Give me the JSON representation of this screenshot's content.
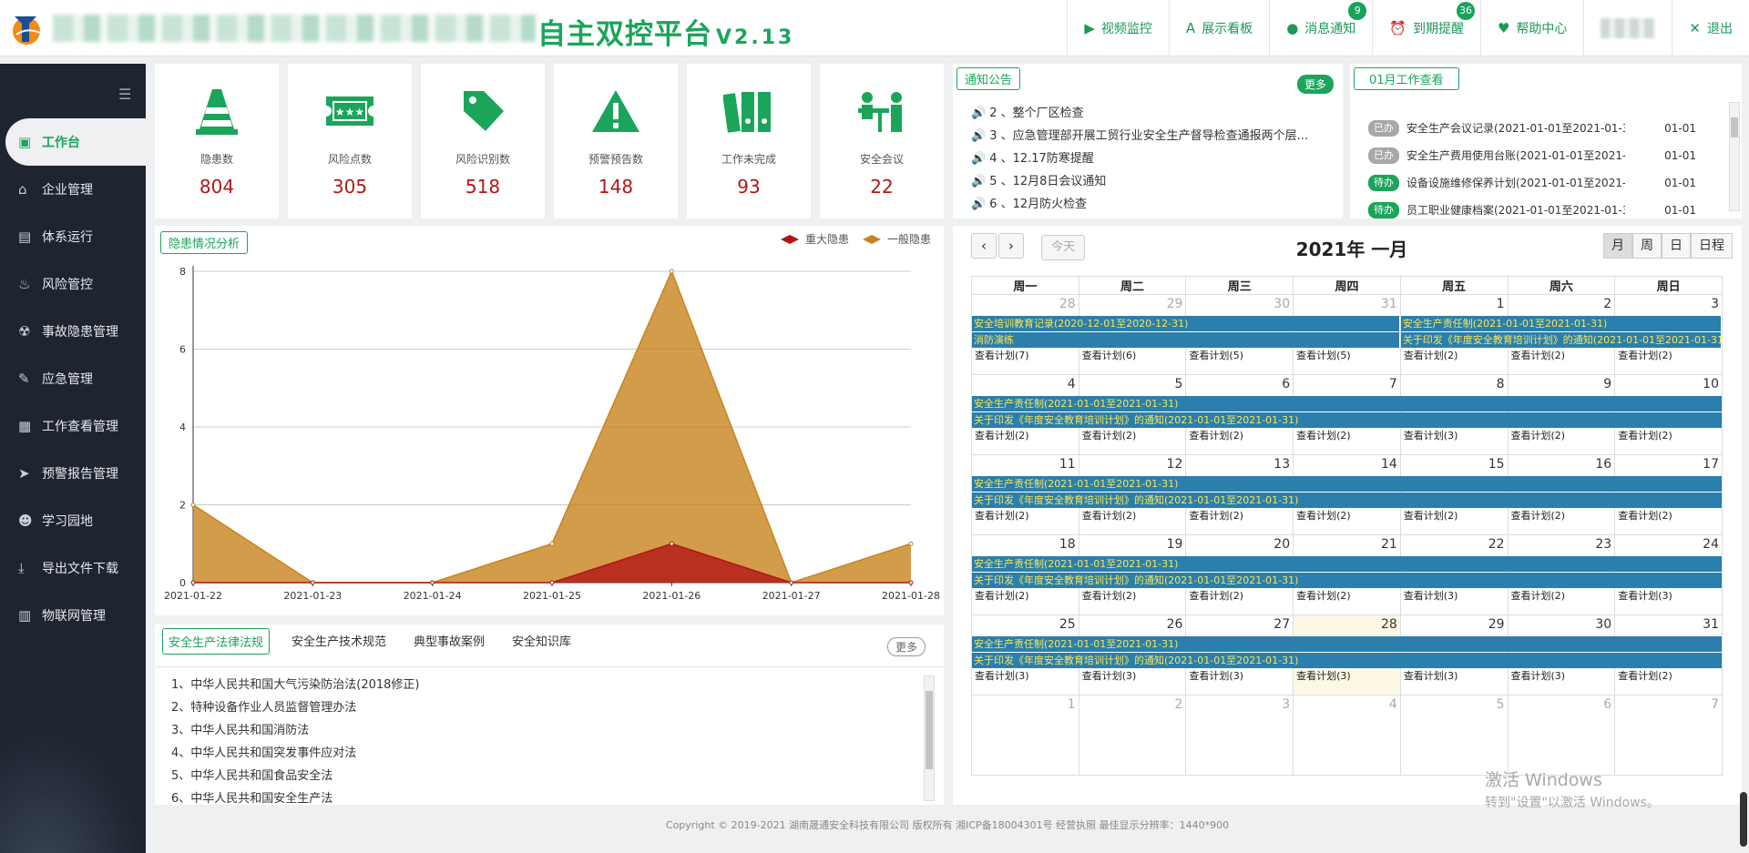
{
  "header": {
    "brand": "自主双控平台",
    "version": "V2.13",
    "nav": [
      {
        "label": "视频监控",
        "icon": "video-icon"
      },
      {
        "label": "展示看板",
        "icon": "board-icon"
      },
      {
        "label": "消息通知",
        "icon": "message-icon",
        "badge": "9"
      },
      {
        "label": "到期提醒",
        "icon": "alarm-icon",
        "badge": "36"
      },
      {
        "label": "帮助中心",
        "icon": "heart-icon"
      },
      {
        "label": "退出",
        "icon": "close-icon"
      }
    ]
  },
  "sidebar": {
    "items": [
      {
        "label": "工作台",
        "icon": "briefcase-icon"
      },
      {
        "label": "企业管理",
        "icon": "home-icon"
      },
      {
        "label": "体系运行",
        "icon": "document-icon"
      },
      {
        "label": "风险管控",
        "icon": "fire-icon"
      },
      {
        "label": "事故隐患管理",
        "icon": "radiation-icon"
      },
      {
        "label": "应急管理",
        "icon": "edit-icon"
      },
      {
        "label": "工作查看管理",
        "icon": "calendar-icon"
      },
      {
        "label": "预警报告管理",
        "icon": "send-icon"
      },
      {
        "label": "学习园地",
        "icon": "student-icon"
      },
      {
        "label": "导出文件下载",
        "icon": "download-icon"
      },
      {
        "label": "物联网管理",
        "icon": "file-icon"
      }
    ]
  },
  "stats": [
    {
      "label": "隐患数",
      "value": "804",
      "icon": "traffic-cone-icon"
    },
    {
      "label": "风险点数",
      "value": "305",
      "icon": "ticket-icon"
    },
    {
      "label": "风险识别数",
      "value": "518",
      "icon": "tag-icon"
    },
    {
      "label": "预警预告数",
      "value": "148",
      "icon": "warning-icon"
    },
    {
      "label": "工作未完成",
      "value": "93",
      "icon": "binders-icon"
    },
    {
      "label": "安全会议",
      "value": "22",
      "icon": "meeting-icon"
    }
  ],
  "notice": {
    "title": "通知公告",
    "more": "更多",
    "items": [
      "2 、整个厂区检查",
      "3 、应急管理部开展工贸行业安全生产督导检查通报两个层...",
      "4 、12.17防寒提醒",
      "5 、12月8日会议通知",
      "6 、12月防火检查"
    ]
  },
  "work": {
    "title": "01月工作查看",
    "items": [
      {
        "status": "已办",
        "type": "done",
        "text": "安全生产会议记录(2021-01-01至2021-01-31)",
        "date": "01-01"
      },
      {
        "status": "已办",
        "type": "done",
        "text": "安全生产费用使用台账(2021-01-01至2021-01-...",
        "date": "01-01"
      },
      {
        "status": "待办",
        "type": "wait",
        "text": "设备设施维修保养计划(2021-01-01至2021-01-...",
        "date": "01-01"
      },
      {
        "status": "待办",
        "type": "wait",
        "text": "员工职业健康档案(2021-01-01至2021-01-31)",
        "date": "01-01"
      }
    ]
  },
  "chart_data": {
    "type": "area",
    "title": "隐患情况分析",
    "categories": [
      "2021-01-22",
      "2021-01-23",
      "2021-01-24",
      "2021-01-25",
      "2021-01-26",
      "2021-01-27",
      "2021-01-28"
    ],
    "series": [
      {
        "name": "重大隐患",
        "values": [
          0,
          0,
          0,
          0,
          1,
          0,
          0
        ],
        "color": "#b31515"
      },
      {
        "name": "一般隐患",
        "values": [
          2,
          0,
          0,
          1,
          8,
          0,
          1
        ],
        "color": "#c8831d"
      }
    ],
    "yticks": [
      "0",
      "2",
      "4",
      "6",
      "8"
    ],
    "ylim": [
      0,
      8
    ],
    "grid": true,
    "legend": "top-right"
  },
  "laws": {
    "tabs": [
      "安全生产法律法规",
      "安全生产技术规范",
      "典型事故案例",
      "安全知识库"
    ],
    "more": "更多",
    "items": [
      "1、中华人民共和国大气污染防治法(2018修正)",
      "2、特种设备作业人员监督管理办法",
      "3、中华人民共和国消防法",
      "4、中华人民共和国突发事件应对法",
      "5、中华人民共和国食品安全法",
      "6、中华人民共和国安全生产法"
    ]
  },
  "calendar": {
    "title": "2021年 一月",
    "today": "今天",
    "views": [
      "月",
      "周",
      "日",
      "日程"
    ],
    "weekdays": [
      "周一",
      "周二",
      "周三",
      "周四",
      "周五",
      "周六",
      "周日"
    ],
    "weeks": [
      {
        "days": [
          {
            "n": "28",
            "o": true
          },
          {
            "n": "29",
            "o": true
          },
          {
            "n": "30",
            "o": true
          },
          {
            "n": "31",
            "o": true
          },
          {
            "n": "1"
          },
          {
            "n": "2"
          },
          {
            "n": "3"
          }
        ],
        "events": [
          {
            "start": 0,
            "span": 4,
            "text": "安全培训教育记录(2020-12-01至2020-12-31)",
            "row": 0
          },
          {
            "start": 4,
            "span": 3,
            "text": "安全生产责任制(2021-01-01至2021-01-31)",
            "row": 0
          },
          {
            "start": 0,
            "span": 4,
            "text": "消防演练",
            "row": 1
          },
          {
            "start": 4,
            "span": 3,
            "text": "关于印发《年度安全教育培训计划》的通知(2021-01-01至2021-01-31)",
            "row": 1
          }
        ],
        "plans": [
          "查看计划(7)",
          "查看计划(6)",
          "查看计划(5)",
          "查看计划(5)",
          "查看计划(2)",
          "查看计划(2)",
          "查看计划(2)"
        ]
      },
      {
        "days": [
          {
            "n": "4"
          },
          {
            "n": "5"
          },
          {
            "n": "6"
          },
          {
            "n": "7"
          },
          {
            "n": "8"
          },
          {
            "n": "9"
          },
          {
            "n": "10"
          }
        ],
        "events": [
          {
            "start": 0,
            "span": 7,
            "text": "安全生产责任制(2021-01-01至2021-01-31)",
            "row": 0
          },
          {
            "start": 0,
            "span": 7,
            "text": "关于印发《年度安全教育培训计划》的通知(2021-01-01至2021-01-31)",
            "row": 1
          }
        ],
        "plans": [
          "查看计划(2)",
          "查看计划(2)",
          "查看计划(2)",
          "查看计划(2)",
          "查看计划(3)",
          "查看计划(2)",
          "查看计划(2)"
        ]
      },
      {
        "days": [
          {
            "n": "11"
          },
          {
            "n": "12"
          },
          {
            "n": "13"
          },
          {
            "n": "14"
          },
          {
            "n": "15"
          },
          {
            "n": "16"
          },
          {
            "n": "17"
          }
        ],
        "events": [
          {
            "start": 0,
            "span": 7,
            "text": "安全生产责任制(2021-01-01至2021-01-31)",
            "row": 0
          },
          {
            "start": 0,
            "span": 7,
            "text": "关于印发《年度安全教育培训计划》的通知(2021-01-01至2021-01-31)",
            "row": 1
          }
        ],
        "plans": [
          "查看计划(2)",
          "查看计划(2)",
          "查看计划(2)",
          "查看计划(2)",
          "查看计划(2)",
          "查看计划(2)",
          "查看计划(2)"
        ]
      },
      {
        "days": [
          {
            "n": "18"
          },
          {
            "n": "19"
          },
          {
            "n": "20"
          },
          {
            "n": "21"
          },
          {
            "n": "22"
          },
          {
            "n": "23"
          },
          {
            "n": "24"
          }
        ],
        "events": [
          {
            "start": 0,
            "span": 7,
            "text": "安全生产责任制(2021-01-01至2021-01-31)",
            "row": 0
          },
          {
            "start": 0,
            "span": 7,
            "text": "关于印发《年度安全教育培训计划》的通知(2021-01-01至2021-01-31)",
            "row": 1
          }
        ],
        "plans": [
          "查看计划(2)",
          "查看计划(2)",
          "查看计划(2)",
          "查看计划(2)",
          "查看计划(3)",
          "查看计划(2)",
          "查看计划(3)"
        ]
      },
      {
        "days": [
          {
            "n": "25"
          },
          {
            "n": "26"
          },
          {
            "n": "27"
          },
          {
            "n": "28",
            "today": true
          },
          {
            "n": "29"
          },
          {
            "n": "30"
          },
          {
            "n": "31"
          }
        ],
        "events": [
          {
            "start": 0,
            "span": 7,
            "text": "安全生产责任制(2021-01-01至2021-01-31)",
            "row": 0
          },
          {
            "start": 0,
            "span": 7,
            "text": "关于印发《年度安全教育培训计划》的通知(2021-01-01至2021-01-31)",
            "row": 1
          }
        ],
        "plans": [
          "查看计划(3)",
          "查看计划(3)",
          "查看计划(3)",
          "查看计划(3)",
          "查看计划(3)",
          "查看计划(3)",
          "查看计划(2)"
        ]
      },
      {
        "days": [
          {
            "n": "1",
            "o": true
          },
          {
            "n": "2",
            "o": true
          },
          {
            "n": "3",
            "o": true
          },
          {
            "n": "4",
            "o": true
          },
          {
            "n": "5",
            "o": true
          },
          {
            "n": "6",
            "o": true
          },
          {
            "n": "7",
            "o": true
          }
        ],
        "events": [],
        "plans": []
      }
    ]
  },
  "footer": "Copyright © 2019-2021 湖南晟通安全科技有限公司 版权所有 湘ICP备18004301号 经营执照   最佳显示分辨率：1440*900",
  "watermark": {
    "line1": "激活 Windows",
    "line2": "转到\"设置\"以激活 Windows。"
  }
}
